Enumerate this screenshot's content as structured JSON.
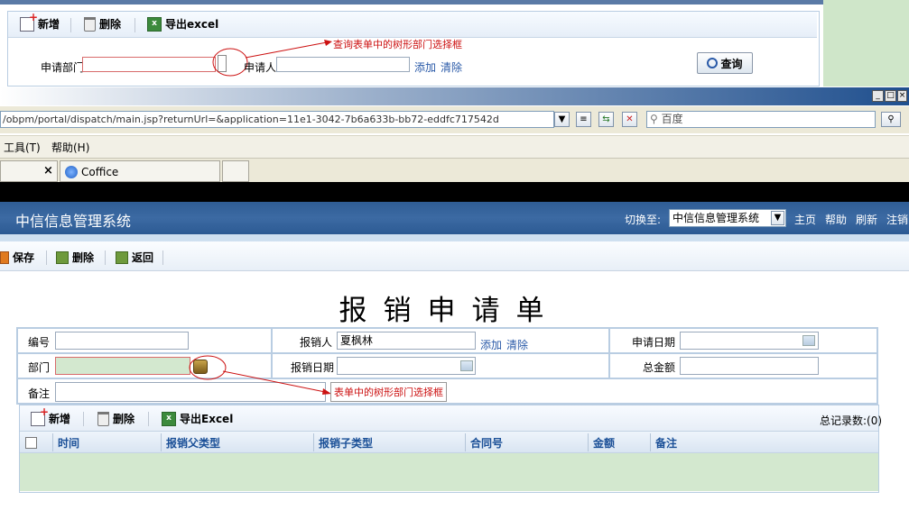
{
  "top_panel": {
    "toolbar": {
      "new_label": "新增",
      "delete_label": "删除",
      "export_label": "导出excel"
    },
    "search": {
      "dept_label": "申请部门",
      "applicant_label": "申请人",
      "add_link": "添加",
      "clear_link": "清除",
      "query_label": "查询"
    },
    "annotation": "查询表单中的树形部门选择框"
  },
  "browser": {
    "address": "/obpm/portal/dispatch/main.jsp?returnUrl=&application=11e1-3042-7b6a633b-bb72-eddfc717542d",
    "search_placeholder": "百度",
    "menu": [
      "工具(T)",
      "帮助(H)"
    ],
    "tab_close": "×",
    "tab_label": "Coffice"
  },
  "app": {
    "title": "中信信息管理系统",
    "switch_label": "切换至:",
    "system_select": "中信信息管理系统",
    "nav": [
      "主页",
      "帮助",
      "刷新",
      "注销"
    ]
  },
  "page_toolbar": {
    "save": "保存",
    "delete": "删除",
    "back": "返回"
  },
  "form": {
    "title": "报销申请单",
    "labels": {
      "number": "编号",
      "reimburser": "报销人",
      "apply_date": "申请日期",
      "dept": "部门",
      "reimburse_date": "报销日期",
      "total": "总金额",
      "remark": "备注"
    },
    "reimburser_value": "夏枫林",
    "add_link": "添加",
    "clear_link": "清除",
    "annotation": "表单中的树形部门选择框"
  },
  "grid": {
    "toolbar": {
      "new_label": "新增",
      "delete_label": "删除",
      "export_label": "导出Excel",
      "count": "总记录数:(0)"
    },
    "columns": [
      "时间",
      "报销父类型",
      "报销子类型",
      "合同号",
      "金额",
      "备注"
    ]
  },
  "colors": {
    "accent": "#2f5d95",
    "annotation": "#cc1111",
    "highlight": "#d3e8cf"
  }
}
